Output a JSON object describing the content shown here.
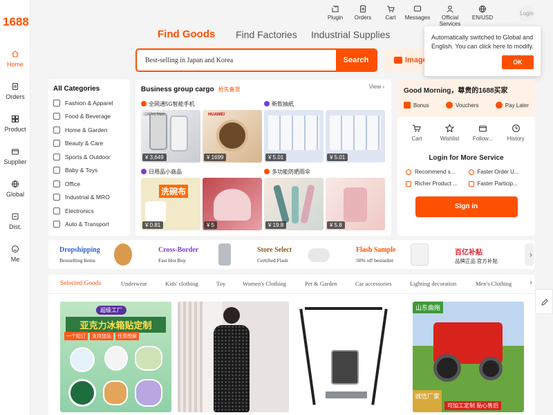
{
  "brand": {
    "logo": "1688",
    "accent": "#ff5000"
  },
  "rail": [
    {
      "label": "Home",
      "icon": "home-icon",
      "active": true
    },
    {
      "label": "Orders",
      "icon": "orders-icon"
    },
    {
      "label": "Product",
      "icon": "product-icon"
    },
    {
      "label": "Supplier",
      "icon": "supplier-icon"
    },
    {
      "label": "Global",
      "icon": "globe-icon"
    },
    {
      "label": "Dist.",
      "icon": "distribution-icon"
    },
    {
      "label": "Me",
      "icon": "me-icon"
    }
  ],
  "topnav": [
    {
      "label": "Plugin",
      "icon": "plugin-icon"
    },
    {
      "label": "Orders",
      "icon": "orders-icon"
    },
    {
      "label": "Cart",
      "icon": "cart-icon"
    },
    {
      "label": "Messages",
      "icon": "messages-icon"
    },
    {
      "label": "Official Services",
      "icon": "user-icon"
    },
    {
      "label": "EN/USD",
      "icon": "globe-icon"
    }
  ],
  "login_label": "Login",
  "popup": {
    "text": "Automatically switched to Global and English. You can click here to modify.",
    "ok": "OK"
  },
  "search": {
    "tabs": [
      "Find Goods",
      "Find Factories",
      "Industrial Supplies"
    ],
    "value": "Best-selling in Japan and Korea",
    "button": "Search",
    "image_search": "Image"
  },
  "categories": {
    "title": "All Categories",
    "items": [
      "Fashion & Apparel",
      "Food & Beverage",
      "Home & Garden",
      "Beauty & Care",
      "Sports & Outdoor",
      "Baby & Toys",
      "Office",
      "Industrial & MRO",
      "Electronics",
      "Auto & Transport"
    ]
  },
  "cargo": {
    "title": "Business group cargo",
    "subtitle": "抢先备货",
    "view": "View",
    "groups": [
      {
        "label": "全网通5G智能手机",
        "products": [
          {
            "price": "¥ 3,649",
            "caption": "i16Pro Max"
          },
          {
            "price": "¥ 1699",
            "caption": "HUAWEI"
          }
        ]
      },
      {
        "label": "新款抽纸",
        "products": [
          {
            "price": "¥ 5.01"
          },
          {
            "price": "¥ 5.01"
          }
        ]
      },
      {
        "label": "日用品小商品",
        "products": [
          {
            "price": "¥ 0.81",
            "caption": "洗碗布"
          },
          {
            "price": "¥ 5"
          }
        ]
      },
      {
        "label": "多功能防晒雨伞",
        "products": [
          {
            "price": "¥ 19.8"
          },
          {
            "price": "¥ 5.8"
          }
        ]
      }
    ]
  },
  "user": {
    "greeting": "Good Morning，尊贵的1688买家",
    "perks": [
      "Bonus",
      "Vouchers",
      "Pay Later"
    ],
    "quick": [
      "Cart",
      "Wishlist",
      "Follow...",
      "History"
    ],
    "login_more": "Login for More Service",
    "services": [
      "Recommend s...",
      "Faster Order U...",
      "Richer Product ...",
      "Faster Particip..."
    ],
    "signin": "Sign in"
  },
  "promos": [
    {
      "title": "Dropshipping",
      "sub": "Bestselling Items",
      "color": "#2a63d6"
    },
    {
      "title": "Cross-Border",
      "sub": "Fast Hot Buy",
      "color": "#7a3fd0"
    },
    {
      "title": "Store Select",
      "sub": "Certified Flash",
      "color": "#8a5a1a"
    },
    {
      "title": "Flash Sample",
      "sub": "50% off bestseller",
      "color": "#ff5000"
    },
    {
      "title": "百亿补贴",
      "sub": "品牌正品 官方补贴",
      "color": "#e0202e"
    }
  ],
  "tabs": [
    "Selected Goods",
    "Underwear",
    "Kids' clothing",
    "Toy",
    "Women's Clothing",
    "Pet & Garden",
    "Car accessories",
    "Lighting decoration",
    "Men's Clothing"
  ],
  "cards": [
    {
      "label": "超级工厂",
      "headline": "亚克力冰箱贴定制",
      "chips": [
        "一个起订",
        "支持加急",
        "任意图案"
      ]
    },
    {
      "label": "dress"
    },
    {
      "label": "swing chair"
    },
    {
      "label": "山东曲拖",
      "badge": "诚信厂家",
      "footer": "可加工定制 贴心售后"
    }
  ]
}
